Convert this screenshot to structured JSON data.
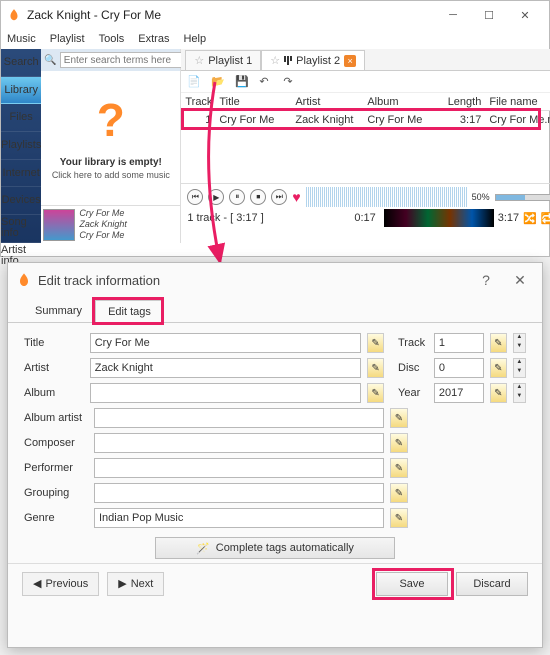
{
  "window": {
    "title": "Zack Knight - Cry For Me"
  },
  "menu": [
    "Music",
    "Playlist",
    "Tools",
    "Extras",
    "Help"
  ],
  "sidebar": {
    "items": [
      {
        "label": "Search"
      },
      {
        "label": "Library"
      },
      {
        "label": "Files"
      },
      {
        "label": "Playlists"
      },
      {
        "label": "Internet"
      },
      {
        "label": "Devices"
      },
      {
        "label": "Song info"
      },
      {
        "label": "Artist info"
      }
    ]
  },
  "search": {
    "placeholder": "Enter search terms here",
    "button": "▶"
  },
  "library_empty": {
    "heading": "Your library is empty!",
    "sub": "Click here to add some music"
  },
  "nowplaying": {
    "line1": "Cry For Me",
    "line2": "Zack Knight",
    "line3": "Cry For Me"
  },
  "playlist_tabs": [
    {
      "label": "Playlist 1"
    },
    {
      "label": "Playlist 2"
    }
  ],
  "table": {
    "headers": [
      "Track",
      "Title",
      "Artist",
      "Album",
      "Length",
      "File name"
    ],
    "rows": [
      {
        "track": "1",
        "title": "Cry For Me",
        "artist": "Zack Knight",
        "album": "Cry For Me",
        "length": "3:17",
        "filename": "Cry For Me.m"
      }
    ]
  },
  "player": {
    "summary": "1 track - [ 3:17 ]",
    "pos_left": "0:17",
    "pos_right": "3:17",
    "vol": "50%"
  },
  "dialog": {
    "title": "Edit track information",
    "tabs": [
      "Summary",
      "Edit tags"
    ],
    "labels": {
      "title": "Title",
      "artist": "Artist",
      "album": "Album",
      "album_artist": "Album artist",
      "composer": "Composer",
      "performer": "Performer",
      "grouping": "Grouping",
      "genre": "Genre",
      "track": "Track",
      "disc": "Disc",
      "year": "Year"
    },
    "values": {
      "title": "Cry For Me",
      "artist": "Zack Knight",
      "album": "",
      "album_artist": "",
      "composer": "",
      "performer": "",
      "grouping": "",
      "genre": "Indian Pop Music",
      "track": "1",
      "disc": "0",
      "year": "2017"
    },
    "auto": "Complete tags automatically",
    "prev": "Previous",
    "next": "Next",
    "save": "Save",
    "discard": "Discard"
  }
}
